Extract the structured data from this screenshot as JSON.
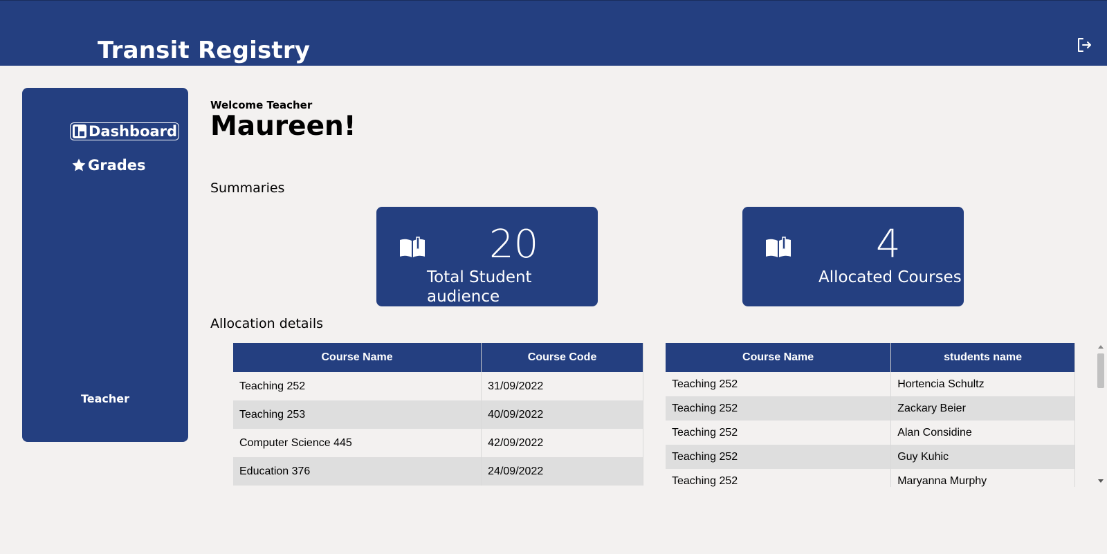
{
  "header": {
    "app_title": "Transit Registry",
    "logout_icon": "logout-icon"
  },
  "sidebar": {
    "items": [
      {
        "label": "Dashboard",
        "icon": "dashboard-icon",
        "active": true
      },
      {
        "label": "Grades",
        "icon": "star-icon",
        "active": false
      }
    ],
    "role": "Teacher"
  },
  "greeting": {
    "welcome": "Welcome Teacher",
    "name": "Maureen!"
  },
  "summaries": {
    "title": "Summaries",
    "cards": [
      {
        "value": "20",
        "label": "Total Student audience",
        "icon": "open-book-icon"
      },
      {
        "value": "4",
        "label": "Allocated Courses",
        "icon": "open-book-icon"
      }
    ]
  },
  "allocation": {
    "title": "Allocation details",
    "courses_table": {
      "headers": [
        "Course Name",
        "Course Code"
      ],
      "rows": [
        [
          "Teaching 252",
          "31/09/2022"
        ],
        [
          "Teaching 253",
          "40/09/2022"
        ],
        [
          "Computer Science 445",
          "42/09/2022"
        ],
        [
          "Education 376",
          "24/09/2022"
        ]
      ]
    },
    "students_table": {
      "headers": [
        "Course Name",
        "students name"
      ],
      "rows": [
        [
          "Teaching 252",
          "Hortencia Schultz"
        ],
        [
          "Teaching 252",
          "Zackary Beier"
        ],
        [
          "Teaching 252",
          "Alan Considine"
        ],
        [
          "Teaching 252",
          "Guy Kuhic"
        ],
        [
          "Teaching 252",
          "Maryanna Murphy"
        ]
      ]
    }
  },
  "colors": {
    "brand": "#243f80",
    "background": "#f3f1f0",
    "row_alt": "#dedede"
  }
}
